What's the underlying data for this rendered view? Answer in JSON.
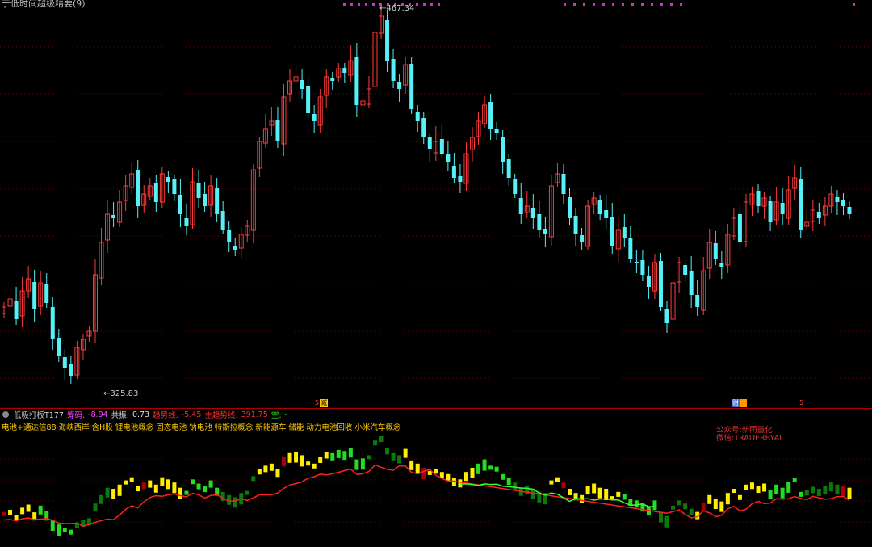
{
  "window_title": "于低时间超级精要(9)",
  "price_high_label": "467.34",
  "price_low_label": "325.83",
  "event_badges": {
    "left_small": "5",
    "jian": "减",
    "caibao": "财",
    "right_small": "5"
  },
  "indicator": {
    "name": "低吸打板T177",
    "chouma_label": "筹码:",
    "chouma_value": "-8.94",
    "gongzhen_label": "共振:",
    "gongzhen_value": "0.73",
    "qushi_label": "趋势线:",
    "qushi_value": "-5.45",
    "zhu_label": "主趋势线:",
    "zhu_value": "391.75",
    "kong_label": "空:",
    "kong_value": "-"
  },
  "concepts_text": "电池+通达信88 海峡西岸 含H股 锂电池概念 固态电池 钠电池 特斯拉概念 新能源车 储能 动力电池回收 小米汽车概念",
  "watermark": {
    "line1": "公众号:新雨量化",
    "line2": "微信:TRADERBYAI"
  },
  "colors": {
    "up": "#ff3b3b",
    "down": "#54f1f7",
    "yellow": "#ffee00",
    "green": "#22dd22",
    "darkgreen": "#0a7a0a",
    "trend_red": "#ff2020",
    "trend_green": "#33ff33"
  }
}
